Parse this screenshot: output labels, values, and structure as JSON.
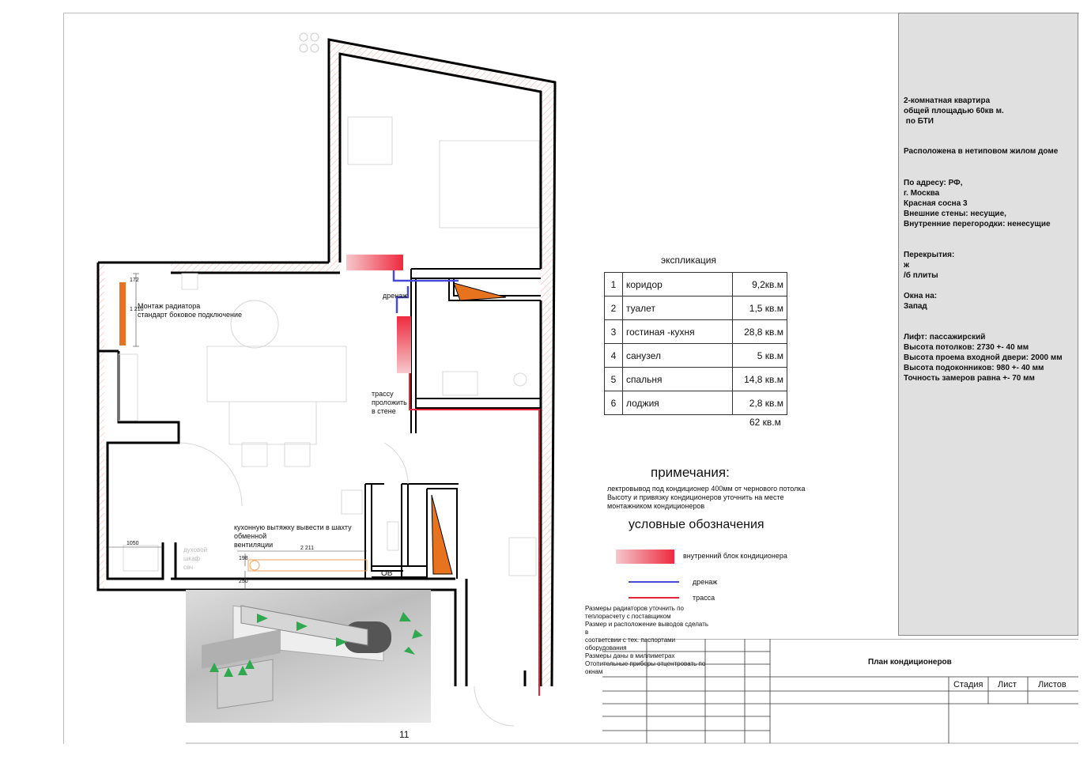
{
  "building_info": {
    "line1": "2-комнатная квартира",
    "line2": "общей площадью 60кв м.",
    "line3": " по БТИ",
    "located": "Расположена в нетиповом жилом доме",
    "address_label": "По адресу: РФ,",
    "city": "г. Москва",
    "street": "Красная сосна 3",
    "outer_walls": "Внешние стены: несущие,",
    "inner_walls": "Внутренние перегородки: ненесущие",
    "floors_label": "Перекрытия:",
    "floors_val1": "ж",
    "floors_val2": "/б плиты",
    "windows_label": "Окна на:",
    "windows_val": "Запад",
    "lift": "Лифт: пассажирский",
    "ceiling": "Высота потолков: 2730 +- 40 мм",
    "door": "Высота проема входной двери: 2000 мм",
    "sill": "Высота подоконников: 980 +- 40 мм",
    "accuracy": "Точность замеров равна +- 70 мм"
  },
  "explication": {
    "title": "экспликация",
    "rows": [
      {
        "n": "1",
        "name": "коридор",
        "area": "9,2кв.м"
      },
      {
        "n": "2",
        "name": "туалет",
        "area": "1,5 кв.м"
      },
      {
        "n": "3",
        "name": "гостиная -кухня",
        "area": "28,8 кв.м"
      },
      {
        "n": "4",
        "name": "санузел",
        "area": "5 кв.м"
      },
      {
        "n": "5",
        "name": "спальня",
        "area": "14,8 кв.м"
      },
      {
        "n": "6",
        "name": "лоджия",
        "area": "2,8 кв.м"
      }
    ],
    "total": "62 кв.м"
  },
  "notes": {
    "title": "примечания:",
    "text": "лектровывод под кондиционер 400мм от чернового потолка\nВысоту и привязку кондиционеров уточнить на месте\nмонтажником кондиционеров"
  },
  "legend": {
    "title": "условные обозначения",
    "indoor_unit": "внутренний блок кондиционера",
    "drain": "дренаж",
    "route": "трасса",
    "colors": {
      "drain": "#4a4ad8",
      "route": "#e8233a",
      "unit": "#ee2a3e",
      "radiator": "#e8731e"
    }
  },
  "remarks": "Размеры радиаторов уточнить по\nтеплорасчету с поставщиком\nРазмер и расположение выводов сделать\nв\nсоответсвии с тех. паспортами\nоборудования\nРазмеры даны в миллиметрах\nОтопительные приборы отцентровать по\nокнам",
  "plan_labels": {
    "radiator": "Монтаж радиатора\nстандарт боковое подключение",
    "drain": "дренаж",
    "route_wall": "трассу\nпроложить\nв стене",
    "hood": "кухонную вытяжку вывести в шахту\nобменной\nвентиляции",
    "ov": "ОВ",
    "dim_2211": "2 211",
    "dim_1050": "1050",
    "dim_198": "198",
    "dim_250": "250",
    "dim_172": "172",
    "dim_1210": "1 210",
    "oven": "духовой\nшкаф\nсвч"
  },
  "title_block": {
    "drawing_title": "План кондиционеров",
    "stage": "Стадия",
    "sheet": "Лист",
    "sheets": "Листов"
  },
  "page_number": "11"
}
